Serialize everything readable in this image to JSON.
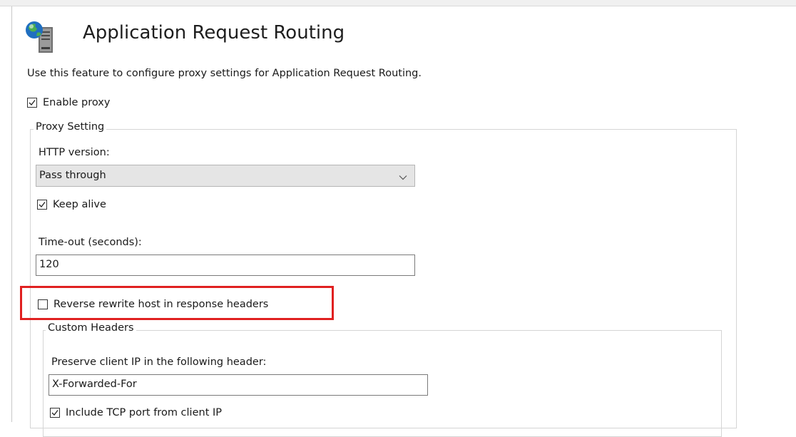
{
  "header": {
    "icon": "globe-server-icon",
    "title": "Application Request Routing",
    "description": "Use this feature to configure proxy settings for Application Request Routing."
  },
  "enable_proxy": {
    "label": "Enable proxy",
    "checked": true
  },
  "proxy_setting": {
    "legend": "Proxy Setting",
    "http_version": {
      "label": "HTTP version:",
      "value": "Pass through"
    },
    "keep_alive": {
      "label": "Keep alive",
      "checked": true
    },
    "timeout": {
      "label": "Time-out (seconds):",
      "value": "120"
    },
    "reverse_rewrite": {
      "label": "Reverse rewrite host in response headers",
      "checked": false,
      "highlight_color": "#e02020"
    }
  },
  "custom_headers": {
    "legend": "Custom Headers",
    "preserve_ip": {
      "label": "Preserve client IP in the following header:",
      "value": "X-Forwarded-For"
    },
    "include_tcp_port": {
      "label": "Include TCP port from client IP",
      "checked": true
    }
  }
}
